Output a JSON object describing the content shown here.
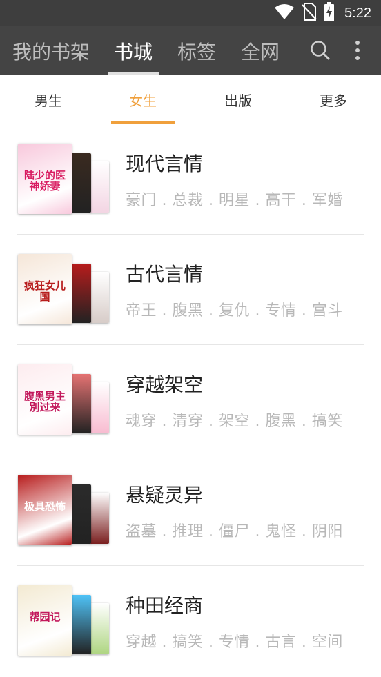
{
  "status_bar": {
    "time": "5:22",
    "icons": [
      "wifi-icon",
      "no-sim-icon",
      "battery-charging-icon"
    ]
  },
  "app_bar": {
    "tabs": [
      {
        "label": "我的书架",
        "active": false
      },
      {
        "label": "书城",
        "active": true
      },
      {
        "label": "标签",
        "active": false
      },
      {
        "label": "全网",
        "active": false
      }
    ],
    "icons": [
      "search-icon",
      "more-vert-icon"
    ]
  },
  "sub_tabs": [
    {
      "label": "男生",
      "active": false
    },
    {
      "label": "女生",
      "active": true
    },
    {
      "label": "出版",
      "active": false
    },
    {
      "label": "更多",
      "active": false
    }
  ],
  "categories": [
    {
      "title": "现代言情",
      "tags": "豪门 . 总裁 . 明星 . 高干 . 军婚",
      "cover_text": "陆少的医神娇妻",
      "colors": [
        "#f8c8dc",
        "#3a2a20",
        "#f3d5e3"
      ],
      "text_color": "#d81b60"
    },
    {
      "title": "古代言情",
      "tags": "帝王 . 腹黑 . 复仇 . 专情 . 宫斗",
      "cover_text": "疯狂女儿国",
      "colors": [
        "#f5e6d8",
        "#b71c1c",
        "#d7ccc8"
      ],
      "text_color": "#b71c1c"
    },
    {
      "title": "穿越架空",
      "tags": "魂穿 . 清穿 . 架空 . 腹黑 . 搞笑",
      "cover_text": "腹黑男主別过来",
      "colors": [
        "#fdecef",
        "#e57373",
        "#f8bbd0"
      ],
      "text_color": "#c2185b"
    },
    {
      "title": "悬疑灵异",
      "tags": "盗墓 . 推理 . 僵尸 . 鬼怪 . 阴阳",
      "cover_text": "极具恐怖",
      "colors": [
        "#b71c1c",
        "#2b2b2b",
        "#7a1f1f"
      ],
      "text_color": "#ffffff"
    },
    {
      "title": "种田经商",
      "tags": "穿越 . 搞笑 . 专情 . 古言 . 空间",
      "cover_text": "帮园记",
      "colors": [
        "#f3ead2",
        "#4fc3f7",
        "#aed581"
      ],
      "text_color": "#c2185b"
    }
  ],
  "theme": {
    "status_bg": "#3e3e3e",
    "appbar_bg": "#444444",
    "accent": "#f0a03c"
  }
}
